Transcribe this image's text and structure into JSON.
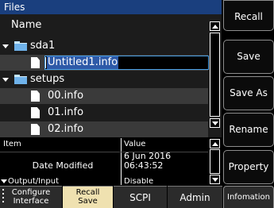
{
  "files_panel": {
    "title": "Files",
    "column_header": "Name",
    "tree": [
      {
        "type": "folder",
        "name": "sda1",
        "expanded": true,
        "depth": 0
      },
      {
        "type": "file",
        "name": "Untitled1.info",
        "depth": 1,
        "editing": true
      },
      {
        "type": "folder",
        "name": "setups",
        "expanded": true,
        "depth": 0
      },
      {
        "type": "file",
        "name": "00.info",
        "depth": 1
      },
      {
        "type": "file",
        "name": "01.info",
        "depth": 1
      },
      {
        "type": "file",
        "name": "02.info",
        "depth": 1
      }
    ]
  },
  "properties_panel": {
    "col_item": "Item",
    "col_value": "Value",
    "rows": [
      {
        "item": "Date Modified",
        "value_line1": "6 Jun 2016",
        "value_line2": "06:43:52"
      },
      {
        "item": "Output/Input",
        "value": "Disable"
      }
    ]
  },
  "side_buttons": {
    "recall": "Recall",
    "save": "Save",
    "save_as": "Save As",
    "rename": "Rename",
    "property": "Property",
    "information": "Infomation"
  },
  "bottom_tabs": {
    "configure_line1": "Configure",
    "configure_line2": "Interface",
    "recall_save_line1": "Recall",
    "recall_save_line2": "Save",
    "scpi": "SCPI",
    "admin": "Admin"
  },
  "colors": {
    "title_bar": "#1a3f7e",
    "selection": "#2e5aa8",
    "active_tab": "#efe1b0",
    "folder": "#6fb2ea"
  },
  "icons": [
    "chevron-down-icon",
    "folder-icon",
    "drive-folder-icon",
    "document-icon",
    "scroll-up-icon",
    "scroll-down-icon"
  ]
}
